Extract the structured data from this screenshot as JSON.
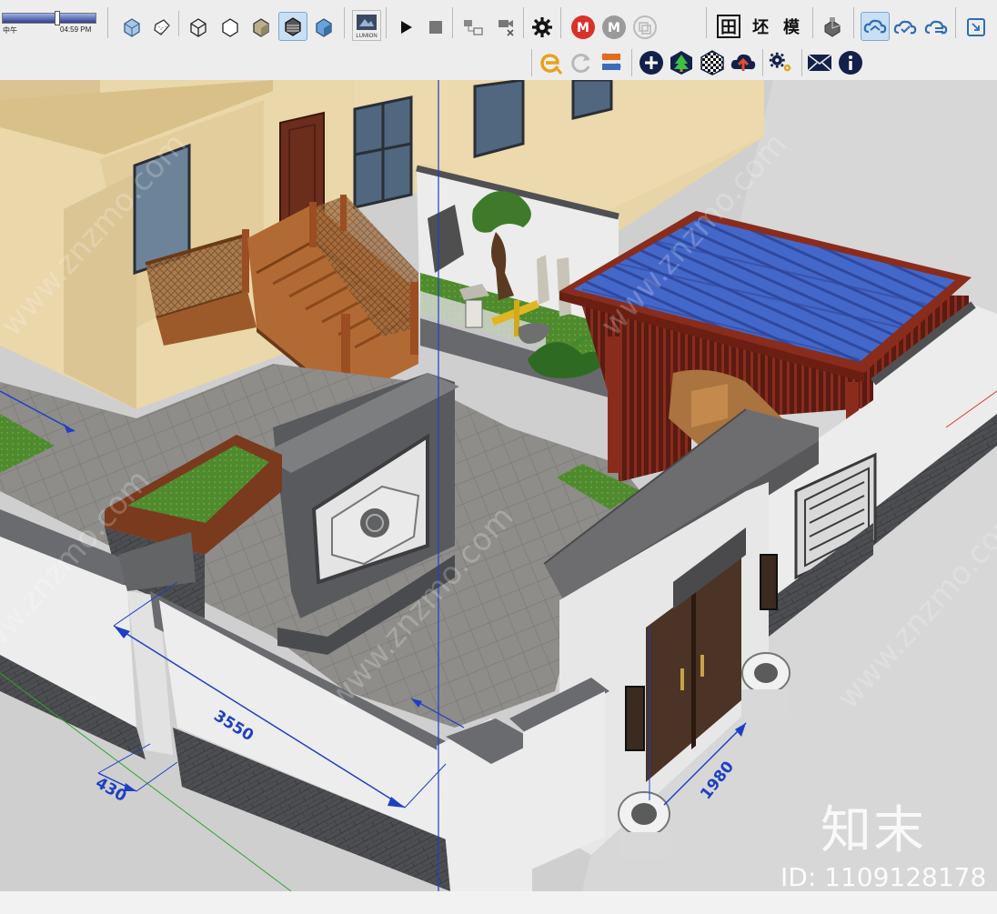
{
  "time_slider": {
    "left_label": "中午",
    "right_label": "04:59 PM",
    "position": 0.6
  },
  "toolbar_row1": {
    "style_buttons": [
      "xray-style-icon",
      "back-edges-icon",
      "wireframe-icon",
      "hidden-line-icon",
      "shaded-icon",
      "shaded-with-textures-icon",
      "monochrome-icon"
    ],
    "lumion": {
      "label": "LUMION"
    },
    "playback": [
      "play-icon",
      "stop-icon"
    ],
    "kanji_buttons": [
      "田",
      "坯",
      "模"
    ],
    "cloud_buttons": [
      "cloud-sync-icon",
      "cloud-check-icon",
      "cloud-list-icon"
    ]
  },
  "toolbar_row2": {
    "buttons": [
      "enscape-icon",
      "refresh-icon",
      "swap-view-icon",
      "add-icon",
      "tree-icon",
      "checker-icon",
      "cloud-upload-icon",
      "settings-icon",
      "mail-icon",
      "info-icon"
    ]
  },
  "dimensions": [
    "3550",
    "430",
    "1980"
  ],
  "watermark": {
    "logo": "知末",
    "id": "ID: 1109128178",
    "site": "www.znzmo.com"
  },
  "colors": {
    "toolbar_bg": "#ededed",
    "dimension_blue": "#1e3fc4",
    "roof_blue": "#3f5fc0",
    "timber": "#8a2c1c"
  }
}
